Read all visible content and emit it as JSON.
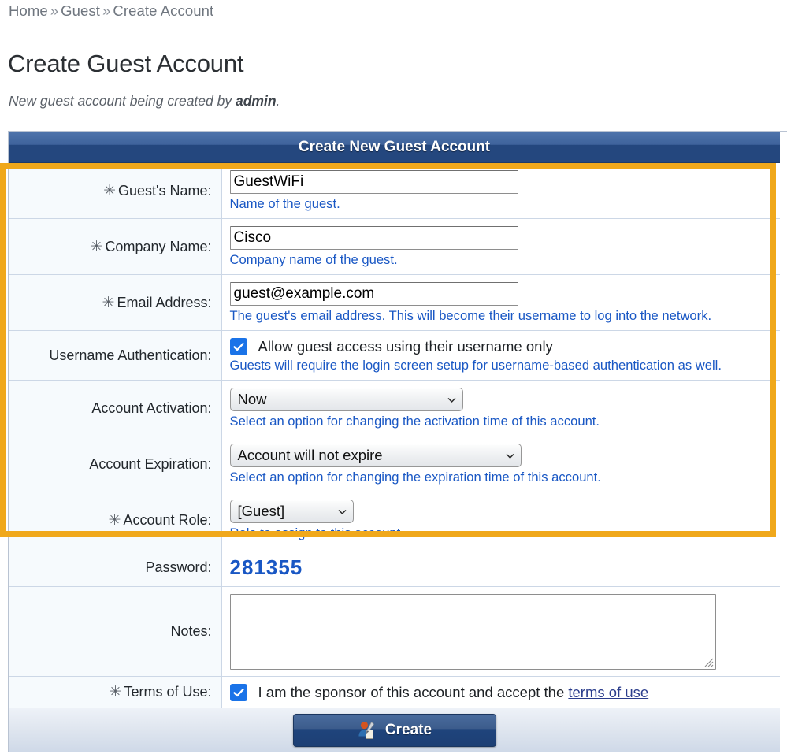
{
  "breadcrumb": {
    "items": [
      "Home",
      "Guest",
      "Create Account"
    ],
    "separator": "»"
  },
  "page_title": "Create Guest Account",
  "subtitle": {
    "prefix": "New guest account being created by ",
    "actor": "admin",
    "suffix": "."
  },
  "panel": {
    "header_title": "Create New Guest Account",
    "highlight_color": "#f0a81b",
    "header_color": "#24477e",
    "hint_color": "#1957c4"
  },
  "fields": {
    "guest_name": {
      "label": "Guest's Name:",
      "required": true,
      "required_marker": "✳",
      "value": "GuestWiFi",
      "placeholder": "",
      "hint": "Name of the guest."
    },
    "company_name": {
      "label": "Company Name:",
      "required": true,
      "required_marker": "✳",
      "value": "Cisco",
      "placeholder": "",
      "hint": "Company name of the guest."
    },
    "email_address": {
      "label": "Email Address:",
      "required": true,
      "required_marker": "✳",
      "value": "guest@example.com",
      "placeholder": "",
      "hint": "The guest's email address. This will become their username to log into the network."
    },
    "username_authentication": {
      "label": "Username Authentication:",
      "required": false,
      "checked": true,
      "checkbox_label": "Allow guest access using their username only",
      "hint": "Guests will require the login screen setup for username-based authentication as well."
    },
    "account_activation": {
      "label": "Account Activation:",
      "required": false,
      "selected": "Now",
      "hint": "Select an option for changing the activation time of this account."
    },
    "account_expiration": {
      "label": "Account Expiration:",
      "required": false,
      "selected": "Account will not expire",
      "hint": "Select an option for changing the expiration time of this account."
    },
    "account_role": {
      "label": "Account Role:",
      "required": true,
      "required_marker": "✳",
      "selected": "[Guest]",
      "hint": "Role to assign to this account."
    },
    "password": {
      "label": "Password:",
      "required": false,
      "value": "281355"
    },
    "notes": {
      "label": "Notes:",
      "required": false,
      "value": "",
      "placeholder": ""
    },
    "terms_of_use": {
      "label": "Terms of Use:",
      "required": true,
      "required_marker": "✳",
      "checked": true,
      "text_before_link": "I am the sponsor of this account and accept the ",
      "link_text": "terms of use"
    }
  },
  "footer": {
    "create_label": "Create"
  }
}
